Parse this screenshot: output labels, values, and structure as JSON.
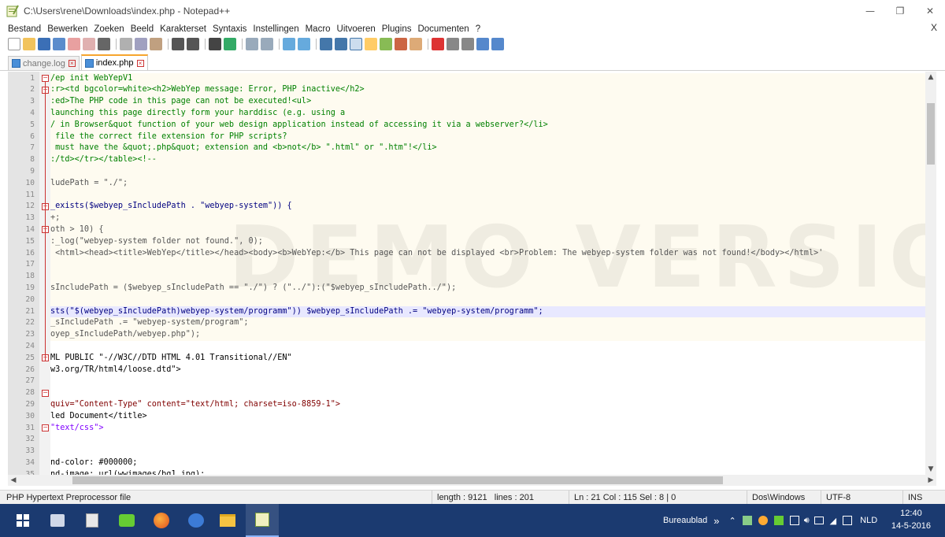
{
  "window": {
    "title": "C:\\Users\\rene\\Downloads\\index.php - Notepad++",
    "minimize": "—",
    "maximize": "❐",
    "close": "✕"
  },
  "menu": {
    "items": [
      "Bestand",
      "Bewerken",
      "Zoeken",
      "Beeld",
      "Karakterset",
      "Syntaxis",
      "Instellingen",
      "Macro",
      "Uitvoeren",
      "Plugins",
      "Documenten",
      "?"
    ],
    "close": "X"
  },
  "tabs": [
    {
      "label": "change.log",
      "active": false
    },
    {
      "label": "index.php",
      "active": true
    }
  ],
  "editor": {
    "watermark": "DEMO VERSION",
    "lines": [
      {
        "n": "1",
        "text": "/ep init WebYepV1"
      },
      {
        "n": "2",
        "text": ":r><td bgcolor=white><h2>WebYep message: Error, PHP inactive</h2>"
      },
      {
        "n": "3",
        "text": ":ed>The PHP code in this page can not be executed!<ul>"
      },
      {
        "n": "4",
        "text": "launching this page directly form your harddisc (e.g. using a"
      },
      {
        "n": "5",
        "text": "/ in Browser&quot function of your web design application instead of accessing it via a webserver?</li>"
      },
      {
        "n": "6",
        "text": " file the correct file extension for PHP scripts?"
      },
      {
        "n": "7",
        "text": " must have the &quot;.php&quot; extension and <b>not</b> \".html\" or \".htm\"!</li>"
      },
      {
        "n": "8",
        "text": ":/td></tr></table><!--"
      },
      {
        "n": "9",
        "text": ""
      },
      {
        "n": "10",
        "text": "ludePath = \"./\";"
      },
      {
        "n": "11",
        "text": ""
      },
      {
        "n": "12",
        "text": "_exists($webyep_sIncludePath . \"webyep-system\")) {"
      },
      {
        "n": "13",
        "text": "+;"
      },
      {
        "n": "14",
        "text": "oth > 10) {"
      },
      {
        "n": "15",
        "text": ":_log(\"webyep-system folder not found.\", 0);"
      },
      {
        "n": "16",
        "text": " <html><head><title>WebYep</title></head><body><b>WebYep:</b> This page can not be displayed <br>Problem: The webyep-system folder was not found!</body></html>'"
      },
      {
        "n": "17",
        "text": ""
      },
      {
        "n": "18",
        "text": ""
      },
      {
        "n": "19",
        "text": "sIncludePath = ($webyep_sIncludePath == \"./\") ? (\"../\"):(\"$webyep_sIncludePath../\");"
      },
      {
        "n": "20",
        "text": ""
      },
      {
        "n": "21",
        "text": "sts(\"$(webyep_sIncludePath)webyep-system/programm\")) $webyep_sIncludePath .= \"webyep-system/programm\";"
      },
      {
        "n": "22",
        "text": "_sIncludePath .= \"webyep-system/program\";"
      },
      {
        "n": "23",
        "text": "oyep_sIncludePath/webyep.php\");"
      },
      {
        "n": "24",
        "text": ""
      },
      {
        "n": "25",
        "text": "ML PUBLIC \"-//W3C//DTD HTML 4.01 Transitional//EN\""
      },
      {
        "n": "26",
        "text": "w3.org/TR/html4/loose.dtd\">"
      },
      {
        "n": "27",
        "text": ""
      },
      {
        "n": "28",
        "text": ""
      },
      {
        "n": "29",
        "text": "quiv=\"Content-Type\" content=\"text/html; charset=iso-8859-1\">"
      },
      {
        "n": "30",
        "text": "led Document</title>"
      },
      {
        "n": "31",
        "text": "\"text/css\">"
      },
      {
        "n": "32",
        "text": ""
      },
      {
        "n": "33",
        "text": ""
      },
      {
        "n": "34",
        "text": "nd-color: #000000;"
      },
      {
        "n": "35",
        "text": "nd-image: url(wwimages/bg1.jpg);"
      }
    ]
  },
  "status": {
    "filetype": "PHP Hypertext Preprocessor file",
    "length": "length : 9121",
    "lines": "lines : 201",
    "position": "Ln : 21   Col : 115   Sel : 8 | 0",
    "eol": "Dos\\Windows",
    "encoding": "UTF-8",
    "mode": "INS"
  },
  "taskbar": {
    "desktop_label": "Bureaublad",
    "chevron": "»",
    "language": "NLD",
    "time": "12:40",
    "date": "14-5-2016"
  },
  "colors": {
    "taskbar_bg": "#1b3a70",
    "tab_accent": "#f7a52e",
    "php_block_bg": "#fefbf0",
    "current_line_bg": "#e8e8ff"
  }
}
